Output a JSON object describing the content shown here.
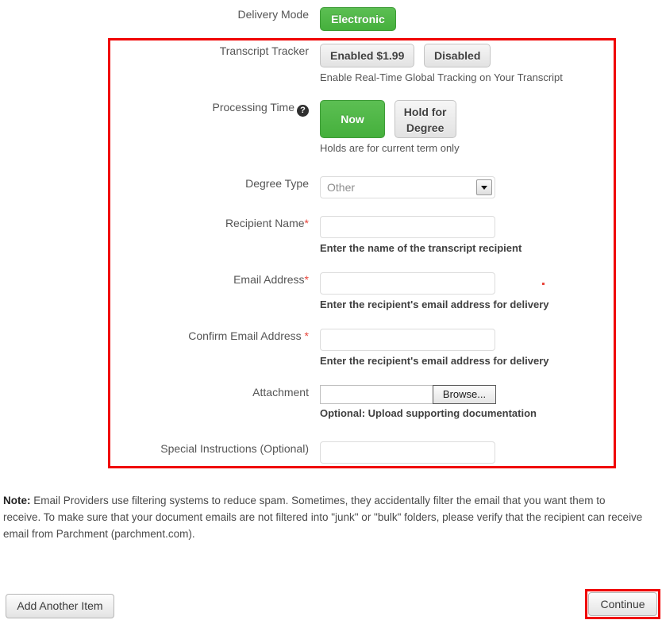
{
  "form": {
    "rows": {
      "delivery_mode": {
        "label": "Delivery Mode",
        "selected_button": "Electronic"
      },
      "transcript_tracker": {
        "label": "Transcript Tracker",
        "enabled_label": "Enabled $1.99",
        "disabled_label": "Disabled",
        "hint": "Enable Real-Time Global Tracking on Your Transcript"
      },
      "processing_time": {
        "label": "Processing Time",
        "help_icon": "question-mark-icon",
        "now_label": "Now",
        "hold_label": "Hold for Degree",
        "hint": "Holds are for current term only"
      },
      "degree_type": {
        "label": "Degree Type",
        "selected_value": "Other"
      },
      "recipient_name": {
        "label": "Recipient Name",
        "required_marker": "*",
        "value": "",
        "hint": "Enter the name of the transcript recipient"
      },
      "email_address": {
        "label": "Email Address",
        "required_marker": "*",
        "value": "",
        "hint": "Enter the recipient's email address for delivery"
      },
      "confirm_email_address": {
        "label": "Confirm Email Address ",
        "required_marker": "*",
        "value": "",
        "hint": "Enter the recipient's email address for delivery"
      },
      "attachment": {
        "label": "Attachment",
        "file_value": "",
        "browse_label": "Browse...",
        "hint": "Optional: Upload supporting documentation"
      },
      "special_instructions": {
        "label": "Special Instructions (Optional)",
        "value": ""
      }
    }
  },
  "note": {
    "prefix": "Note:",
    "text": " Email Providers use filtering systems to reduce spam. Sometimes, they accidentally filter the email that you want them to receive. To make sure that your document emails are not filtered into \"junk\" or \"bulk\" folders, please verify that the recipient can receive email from Parchment (parchment.com)."
  },
  "footer": {
    "add_another_item_label": "Add Another Item",
    "continue_label": "Continue"
  },
  "colors": {
    "accent_green": "#4CB748",
    "annotation_red": "#F00000",
    "required_red": "#E8443A",
    "button_grey": "#E2E2E2"
  }
}
